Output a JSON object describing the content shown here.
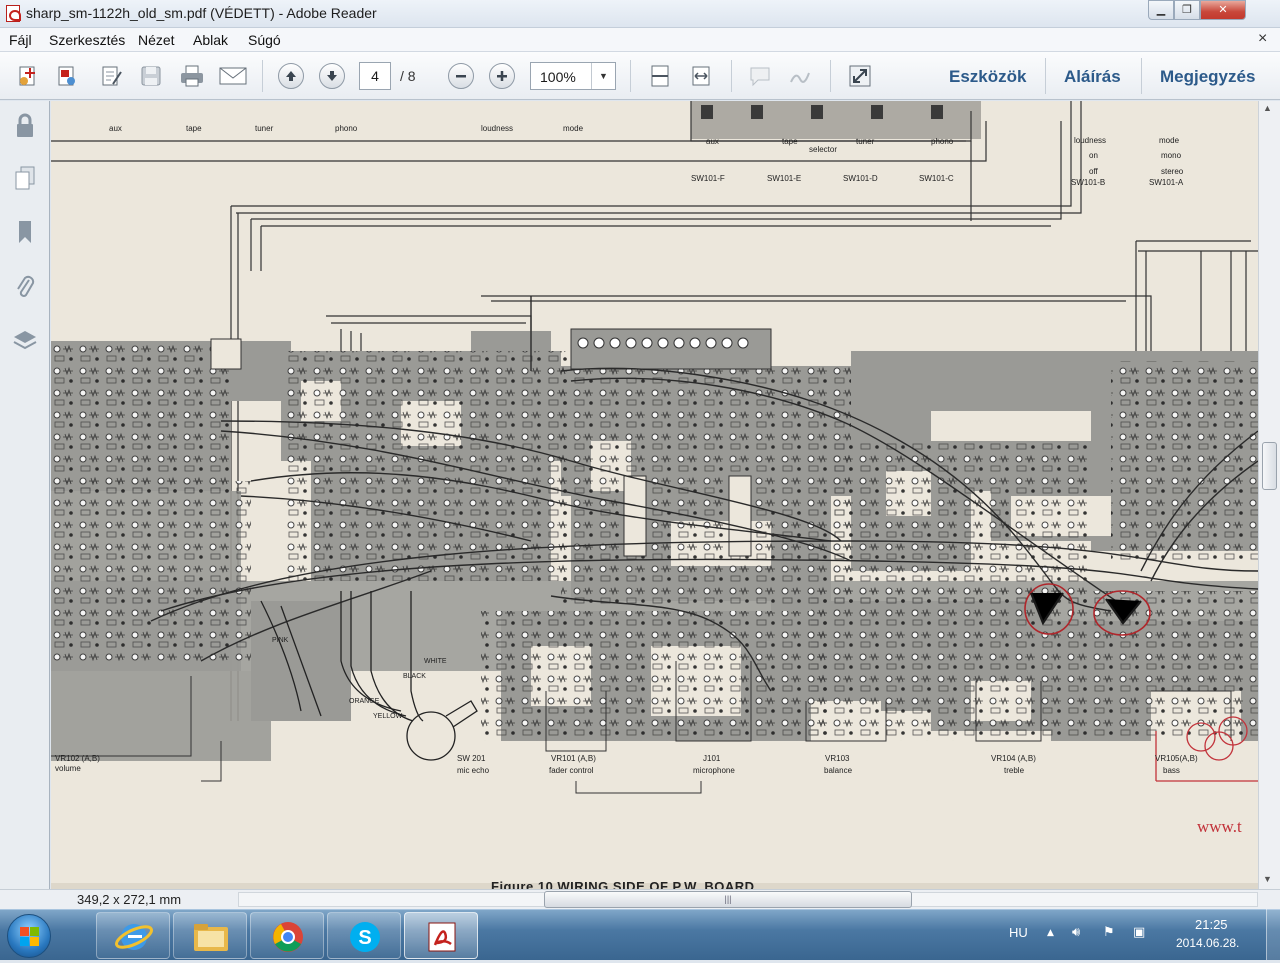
{
  "window": {
    "title": "sharp_sm-1122h_old_sm.pdf (VÉDETT) - Adobe Reader",
    "minimize": "▁",
    "maximize": "❐",
    "close": "✕"
  },
  "menu": {
    "items": [
      "Fájl",
      "Szerkesztés",
      "Nézet",
      "Ablak",
      "Súgó"
    ],
    "close_doc": "×"
  },
  "toolbar": {
    "page_current": "4",
    "page_total": "/ 8",
    "zoom": "100%",
    "zoom_dropdown": "▼",
    "links": [
      "Eszközök",
      "Aláírás",
      "Megjegyzés"
    ]
  },
  "document": {
    "top_labels": [
      "aux",
      "tape",
      "tuner",
      "phono",
      "loudness",
      "mode"
    ],
    "selector_labels": [
      "aux",
      "tape",
      "selector",
      "tuner",
      "phono"
    ],
    "switch_labels": [
      "SW101-F",
      "SW101-E",
      "SW101-D",
      "SW101-C",
      "SW101-B",
      "SW101-A"
    ],
    "mode_labels": [
      "loudness",
      "mode",
      "on",
      "mono",
      "off",
      "stereo"
    ],
    "controls": [
      {
        "ref": "VR102 (A,B)",
        "name": "volume"
      },
      {
        "ref": "SW 201",
        "name": "mic echo"
      },
      {
        "ref": "VR101 (A,B)",
        "name": "fader control"
      },
      {
        "ref": "J101",
        "name": "microphone"
      },
      {
        "ref": "VR103",
        "name": "balance"
      },
      {
        "ref": "VR104 (A,B)",
        "name": "treble"
      },
      {
        "ref": "VR105(A,B)",
        "name": "bass"
      }
    ],
    "wire_colors": [
      "WHITE",
      "PINK",
      "BLACK",
      "ORANGE",
      "YELLOW"
    ],
    "figure_caption": "Figure 10  WIRING  SIDE OF P.W. BOARD",
    "watermark": "www.t"
  },
  "status": {
    "dimensions": "349,2 x 272,1 mm"
  },
  "taskbar": {
    "language": "HU",
    "time": "21:25",
    "date": "2014.06.28."
  },
  "colors": {
    "pdf_red": "#c4221d",
    "toolbar_link": "#2c5a8a",
    "board_grey": "#9a9a96",
    "annotation_red": "#b0262b"
  }
}
